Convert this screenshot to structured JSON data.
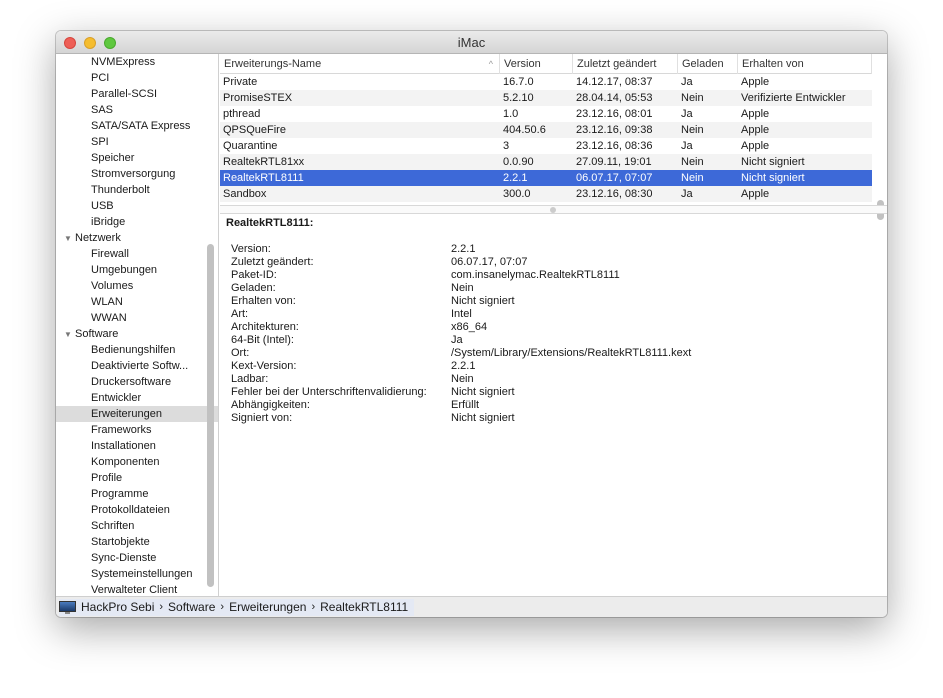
{
  "window": {
    "title": "iMac"
  },
  "sidebar": {
    "items": [
      {
        "label": "NVMExpress",
        "type": "child"
      },
      {
        "label": "PCI",
        "type": "child"
      },
      {
        "label": "Parallel-SCSI",
        "type": "child"
      },
      {
        "label": "SAS",
        "type": "child"
      },
      {
        "label": "SATA/SATA Express",
        "type": "child"
      },
      {
        "label": "SPI",
        "type": "child"
      },
      {
        "label": "Speicher",
        "type": "child"
      },
      {
        "label": "Stromversorgung",
        "type": "child"
      },
      {
        "label": "Thunderbolt",
        "type": "child"
      },
      {
        "label": "USB",
        "type": "child"
      },
      {
        "label": "iBridge",
        "type": "child"
      },
      {
        "label": "Netzwerk",
        "type": "group"
      },
      {
        "label": "Firewall",
        "type": "child"
      },
      {
        "label": "Umgebungen",
        "type": "child"
      },
      {
        "label": "Volumes",
        "type": "child"
      },
      {
        "label": "WLAN",
        "type": "child"
      },
      {
        "label": "WWAN",
        "type": "child"
      },
      {
        "label": "Software",
        "type": "group"
      },
      {
        "label": "Bedienungshilfen",
        "type": "child"
      },
      {
        "label": "Deaktivierte Softw...",
        "type": "child"
      },
      {
        "label": "Druckersoftware",
        "type": "child"
      },
      {
        "label": "Entwickler",
        "type": "child"
      },
      {
        "label": "Erweiterungen",
        "type": "child",
        "selected": true
      },
      {
        "label": "Frameworks",
        "type": "child"
      },
      {
        "label": "Installationen",
        "type": "child"
      },
      {
        "label": "Komponenten",
        "type": "child"
      },
      {
        "label": "Profile",
        "type": "child"
      },
      {
        "label": "Programme",
        "type": "child"
      },
      {
        "label": "Protokolldateien",
        "type": "child"
      },
      {
        "label": "Schriften",
        "type": "child"
      },
      {
        "label": "Startobjekte",
        "type": "child"
      },
      {
        "label": "Sync-Dienste",
        "type": "child"
      },
      {
        "label": "Systemeinstellungen",
        "type": "child"
      },
      {
        "label": "Verwalteter Client",
        "type": "child"
      }
    ]
  },
  "table": {
    "columns": [
      "Erweiterungs-Name",
      "Version",
      "Zuletzt geändert",
      "Geladen",
      "Erhalten von"
    ],
    "rows": [
      [
        "Private",
        "16.7.0",
        "14.12.17, 08:37",
        "Ja",
        "Apple"
      ],
      [
        "PromiseSTEX",
        "5.2.10",
        "28.04.14, 05:53",
        "Nein",
        "Verifizierte Entwickler"
      ],
      [
        "pthread",
        "1.0",
        "23.12.16, 08:01",
        "Ja",
        "Apple"
      ],
      [
        "QPSQueFire",
        "404.50.6",
        "23.12.16, 09:38",
        "Nein",
        "Apple"
      ],
      [
        "Quarantine",
        "3",
        "23.12.16, 08:36",
        "Ja",
        "Apple"
      ],
      [
        "RealtekRTL81xx",
        "0.0.90",
        "27.09.11, 19:01",
        "Nein",
        "Nicht signiert"
      ],
      [
        "RealtekRTL8111",
        "2.2.1",
        "06.07.17, 07:07",
        "Nein",
        "Nicht signiert"
      ],
      [
        "Sandbox",
        "300.0",
        "23.12.16, 08:30",
        "Ja",
        "Apple"
      ]
    ],
    "selected_index": 6
  },
  "detail": {
    "title": "RealtekRTL8111:",
    "fields": [
      [
        "Version:",
        "2.2.1"
      ],
      [
        "Zuletzt geändert:",
        "06.07.17, 07:07"
      ],
      [
        "Paket-ID:",
        "com.insanelymac.RealtekRTL8111"
      ],
      [
        "Geladen:",
        "Nein"
      ],
      [
        "Erhalten von:",
        "Nicht signiert"
      ],
      [
        "Art:",
        "Intel"
      ],
      [
        "Architekturen:",
        "x86_64"
      ],
      [
        "64-Bit (Intel):",
        "Ja"
      ],
      [
        "Ort:",
        "/System/Library/Extensions/RealtekRTL8111.kext"
      ],
      [
        "Kext-Version:",
        "2.2.1"
      ],
      [
        "Ladbar:",
        "Nein"
      ],
      [
        "Fehler bei der Unterschriftenvalidierung:",
        "Nicht signiert"
      ],
      [
        "Abhängigkeiten:",
        "Erfüllt"
      ],
      [
        "Signiert von:",
        "Nicht signiert"
      ]
    ]
  },
  "breadcrumb": [
    "HackPro Sebi",
    "Software",
    "Erweiterungen",
    "RealtekRTL8111"
  ],
  "colors": {
    "selection": "#3d69d8",
    "close": "#ee5f57",
    "minimize": "#f5bd2f",
    "zoom": "#5fc83f"
  }
}
